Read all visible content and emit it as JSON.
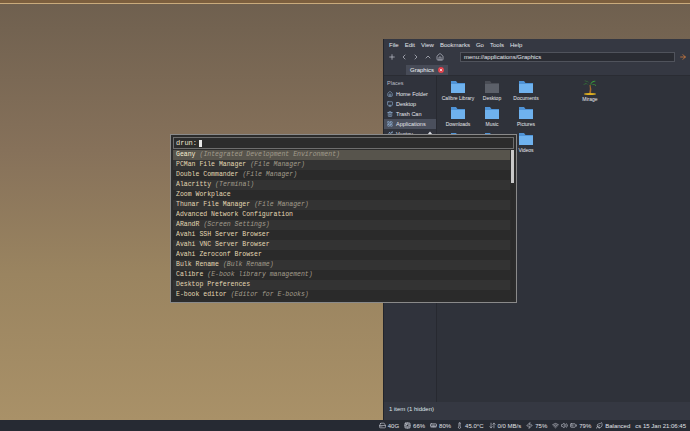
{
  "launcher": {
    "prompt": "drun:",
    "scroll_thumb": 0.22,
    "entries": [
      {
        "name": "Geany",
        "generic": "(Integrated Development Environment)",
        "selected": true
      },
      {
        "name": "PCMan File Manager",
        "generic": "(File Manager)",
        "selected": false
      },
      {
        "name": "Double Commander",
        "generic": "(File Manager)",
        "selected": false
      },
      {
        "name": "Alacritty",
        "generic": "(Terminal)",
        "selected": false
      },
      {
        "name": "Zoom Workplace",
        "generic": "",
        "selected": false
      },
      {
        "name": "Thunar File Manager",
        "generic": "(File Manager)",
        "selected": false
      },
      {
        "name": "Advanced Network Configuration",
        "generic": "",
        "selected": false
      },
      {
        "name": "ARandR",
        "generic": "(Screen Settings)",
        "selected": false
      },
      {
        "name": "Avahi SSH Server Browser",
        "generic": "",
        "selected": false
      },
      {
        "name": "Avahi VNC Server Browser",
        "generic": "",
        "selected": false
      },
      {
        "name": "Avahi Zeroconf Browser",
        "generic": "",
        "selected": false
      },
      {
        "name": "Bulk Rename",
        "generic": "(Bulk Rename)",
        "selected": false
      },
      {
        "name": "Calibre",
        "generic": "(E-book library management)",
        "selected": false
      },
      {
        "name": "Desktop Preferences",
        "generic": "",
        "selected": false
      },
      {
        "name": "E-book editor",
        "generic": "(Editor for E-books)",
        "selected": false
      }
    ]
  },
  "file_manager": {
    "menu": [
      "File",
      "Edit",
      "View",
      "Bookmarks",
      "Go",
      "Tools",
      "Help"
    ],
    "location": "menu://applications/Graphics",
    "tabs": [
      {
        "label": "Graphics",
        "selected": true
      }
    ],
    "places_header": "Places",
    "places": [
      {
        "label": "Home Folder",
        "selected": false
      },
      {
        "label": "Desktop",
        "selected": false
      },
      {
        "label": "Trash Can",
        "selected": false
      },
      {
        "label": "Applications",
        "selected": true
      },
      {
        "label": "Ventoy",
        "selected": false
      }
    ],
    "items": [
      {
        "label": "Calibre Library",
        "kind": "folder"
      },
      {
        "label": "Desktop",
        "kind": "desktop"
      },
      {
        "label": "Documents",
        "kind": "folder"
      },
      {
        "label": "Downloads",
        "kind": "folder"
      },
      {
        "label": "Music",
        "kind": "folder"
      },
      {
        "label": "Pictures",
        "kind": "folder"
      },
      {
        "label": "",
        "kind": "folder"
      },
      {
        "label": "",
        "kind": "folder"
      },
      {
        "label": "Videos",
        "kind": "folder"
      }
    ],
    "app_item": {
      "label": "Mirage",
      "kind": "app"
    },
    "status": "1 item (1 hidden)"
  },
  "panel": {
    "items": [
      {
        "text": "40G"
      },
      {
        "text": "66%"
      },
      {
        "text": "80%"
      },
      {
        "text": "45.0°C"
      },
      {
        "text": "0/0 MB/s"
      },
      {
        "text": "75%"
      },
      {
        "text": "79%"
      },
      {
        "text": "Balanced"
      },
      {
        "text": "cs 15 Jan 21:06:45"
      }
    ]
  }
}
